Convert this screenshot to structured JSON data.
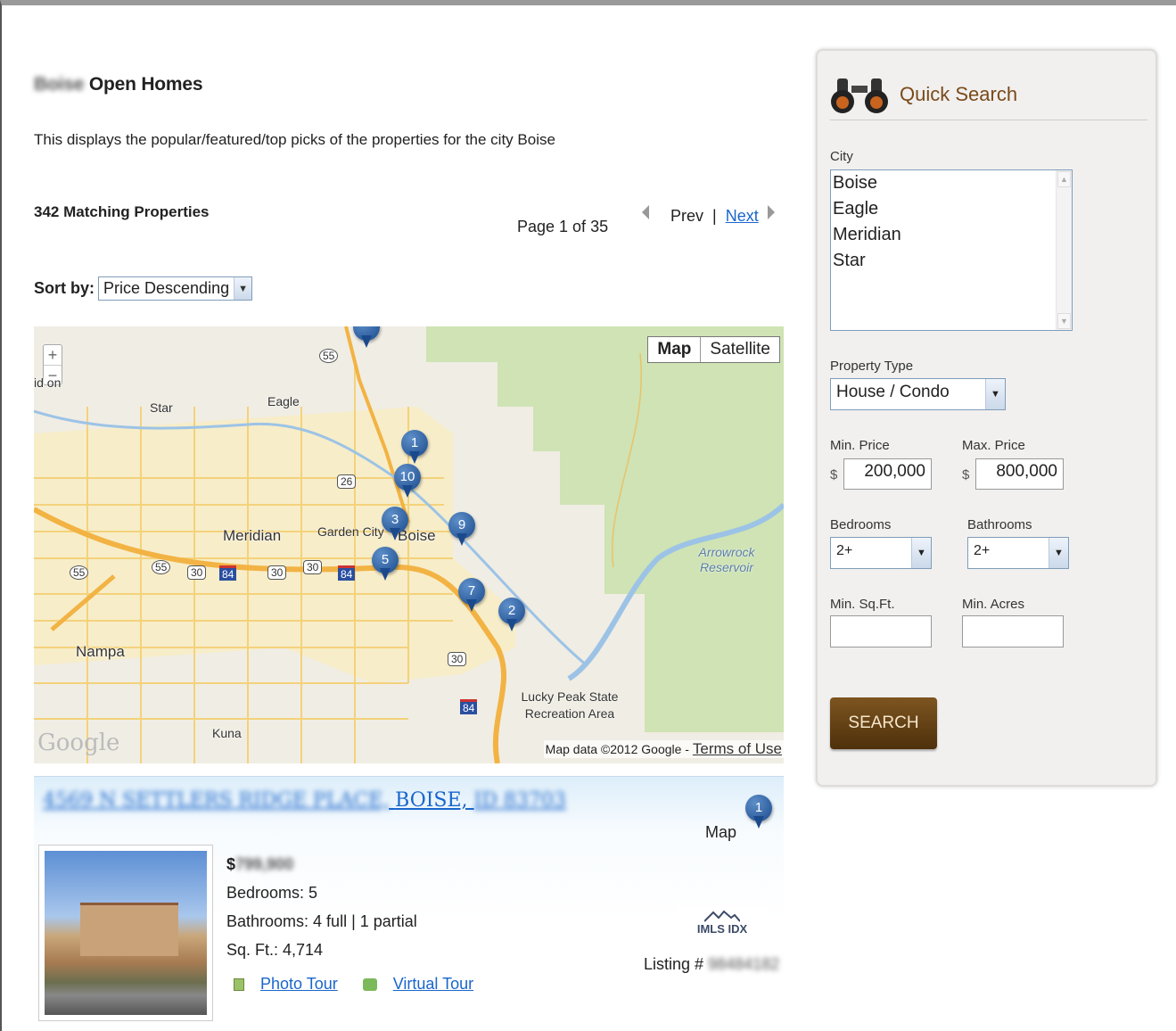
{
  "page": {
    "title_city": "Boise",
    "title_rest": "Open Homes",
    "description": "This displays the popular/featured/top picks of the properties for the city Boise",
    "matching": "342 Matching Properties",
    "page_info": "Page 1 of 35",
    "prev_label": "Prev",
    "separator": "|",
    "next_label": "Next",
    "sort_label": "Sort by:",
    "sort_value": "Price Descending"
  },
  "map": {
    "type_map": "Map",
    "type_satellite": "Satellite",
    "zoom_in": "+",
    "zoom_out": "−",
    "labels": {
      "star": "Star",
      "eagle": "Eagle",
      "meridian": "Meridian",
      "garden_city": "Garden City",
      "boise": "Boise",
      "nampa": "Nampa",
      "kuna": "Kuna",
      "arrowrock": "Arrowrock Reservoir",
      "lucky_peak": "Lucky Peak State Recreation Area",
      "partial_left": "id on"
    },
    "shields": {
      "s55a": "55",
      "s55b": "55",
      "s55c": "55",
      "s26": "26",
      "s30a": "30",
      "s30b": "30",
      "s30c": "30",
      "s30d": "30",
      "s84a": "84",
      "s84b": "84",
      "s84c": "84"
    },
    "google_logo": "Google",
    "data_text": "Map data ©2012 Google - ",
    "terms": "Terms of Use",
    "pins": [
      "1",
      "10",
      "3",
      "9",
      "5",
      "7",
      "2"
    ]
  },
  "listing": {
    "address_blurred": "4569 N SETTLERS RIDGE PLACE,",
    "address_city": "BOISE,",
    "address_state_blurred": "ID 83703",
    "map_label": "Map",
    "pin": "1",
    "price_symbol": "$",
    "price_blurred": "799,900",
    "bedrooms": "Bedrooms: 5",
    "bathrooms": "Bathrooms: 4 full | 1 partial",
    "sqft": "Sq. Ft.: 4,714",
    "photo_tour": "Photo Tour",
    "virtual_tour": "Virtual Tour",
    "imls": "IMLS IDX",
    "listing_label": "Listing #",
    "listing_blurred": "98484182"
  },
  "quick_search": {
    "title": "Quick Search",
    "city_label": "City",
    "cities": [
      "Boise",
      "Eagle",
      "Meridian",
      "Star"
    ],
    "property_type_label": "Property Type",
    "property_type_value": "House / Condo",
    "min_price_label": "Min. Price",
    "max_price_label": "Max. Price",
    "currency": "$",
    "min_price_value": "200,000",
    "max_price_value": "800,000",
    "bedrooms_label": "Bedrooms",
    "bathrooms_label": "Bathrooms",
    "bedrooms_value": "2+",
    "bathrooms_value": "2+",
    "min_sqft_label": "Min. Sq.Ft.",
    "min_acres_label": "Min. Acres",
    "min_sqft_value": "",
    "min_acres_value": "",
    "search_label": "SEARCH"
  },
  "colors": {
    "accent_brown": "#7a4a1a",
    "link_blue": "#1a66cc",
    "pin_blue": "#1b4a8c"
  }
}
